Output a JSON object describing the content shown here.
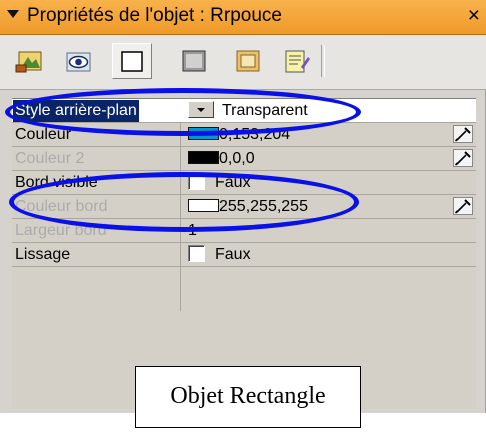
{
  "panel": {
    "title": "Propriétés de l'objet : Rrpouce",
    "close_glyph": "×"
  },
  "toolbar": {
    "buttons": [
      {
        "name": "appearance-icon",
        "active": false
      },
      {
        "name": "visibility-eye-icon",
        "active": false
      },
      {
        "name": "background-style-icon",
        "active": true
      },
      {
        "name": "border-style-icon",
        "active": false
      },
      {
        "name": "frame-style-icon",
        "active": false
      },
      {
        "name": "notes-icon",
        "active": false
      }
    ]
  },
  "properties": {
    "background_style": {
      "label": "Style arrière-plan",
      "value": "Transparent"
    },
    "color": {
      "label": "Couleur",
      "value": "0,153,204",
      "swatch": "#0099cc"
    },
    "color2": {
      "label": "Couleur 2",
      "value": "0,0,0",
      "swatch": "#000000"
    },
    "border_visible": {
      "label": "Bord visible",
      "value": "Faux"
    },
    "border_color": {
      "label": "Couleur bord",
      "value": "255,255,255",
      "swatch": "#ffffff"
    },
    "border_width": {
      "label": "Largeur bord",
      "value": "1"
    },
    "smoothing": {
      "label": "Lissage",
      "value": "Faux"
    }
  },
  "annotations": {
    "callout": "Objet Rectangle",
    "ellipse_color": "#0a10e8"
  },
  "colors": {
    "title_bar": "#f2a33a",
    "selection": "#0a246a",
    "panel_bg": "#d4d0c8"
  }
}
